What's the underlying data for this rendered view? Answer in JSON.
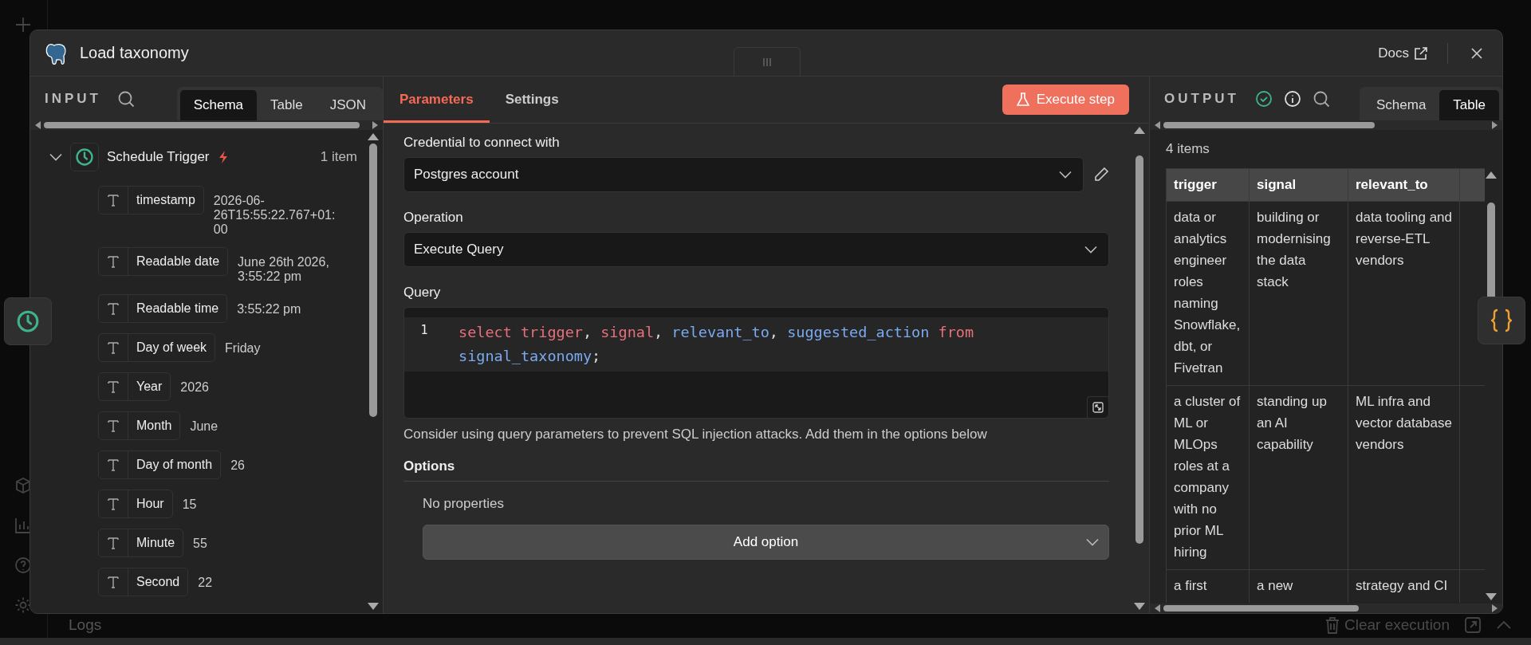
{
  "window": {
    "title": "Load taxonomy",
    "docs_link": "Docs"
  },
  "background": {
    "logs_label": "Logs",
    "clear_button": "Clear execution"
  },
  "input": {
    "title": "INPUT",
    "view_tabs": [
      {
        "label": "Schema",
        "selected": true
      },
      {
        "label": "Table",
        "selected": false
      },
      {
        "label": "JSON",
        "selected": false
      }
    ],
    "node": {
      "name": "Schedule Trigger",
      "count": "1 item",
      "expanded": true,
      "fields": [
        {
          "name": "timestamp",
          "value": "2026-06-26T15:55:22.767+01:00"
        },
        {
          "name": "Readable date",
          "value": "June 26th 2026, 3:55:22 pm"
        },
        {
          "name": "Readable time",
          "value": "3:55:22 pm"
        },
        {
          "name": "Day of week",
          "value": "Friday"
        },
        {
          "name": "Year",
          "value": "2026"
        },
        {
          "name": "Month",
          "value": "June"
        },
        {
          "name": "Day of month",
          "value": "26"
        },
        {
          "name": "Hour",
          "value": "15"
        },
        {
          "name": "Minute",
          "value": "55"
        },
        {
          "name": "Second",
          "value": "22"
        }
      ]
    }
  },
  "parameters": {
    "tabs": [
      {
        "label": "Parameters",
        "selected": true
      },
      {
        "label": "Settings",
        "selected": false
      }
    ],
    "execute_button": "Execute step",
    "credential": {
      "label": "Credential to connect with",
      "value": "Postgres account"
    },
    "operation": {
      "label": "Operation",
      "value": "Execute Query"
    },
    "query": {
      "label": "Query",
      "line_number": "1",
      "tokens": [
        {
          "text": "select",
          "kind": "keyword"
        },
        {
          "text": "trigger",
          "kind": "keyword"
        },
        {
          "text": ",",
          "kind": "punct"
        },
        {
          "text": "signal",
          "kind": "keyword"
        },
        {
          "text": ",",
          "kind": "punct"
        },
        {
          "text": "relevant_to",
          "kind": "name"
        },
        {
          "text": ",",
          "kind": "punct"
        },
        {
          "text": "suggested_action",
          "kind": "name"
        },
        {
          "text": "from",
          "kind": "keyword"
        },
        {
          "text": "signal_taxonomy",
          "kind": "name"
        },
        {
          "text": ";",
          "kind": "punct"
        }
      ]
    },
    "hint": "Consider using query parameters to prevent SQL injection attacks. Add them in the options below",
    "options": {
      "label": "Options",
      "empty_text": "No properties",
      "add_button": "Add option"
    }
  },
  "output": {
    "title": "OUTPUT",
    "view_tabs": [
      {
        "label": "Schema",
        "selected": false
      },
      {
        "label": "Table",
        "selected": true
      }
    ],
    "item_count": "4 items",
    "table": {
      "columns": [
        "trigger",
        "signal",
        "relevant_to"
      ],
      "rows": [
        [
          "data or analytics engineer roles naming Snowflake, dbt, or Fivetran",
          "building or modernising the data stack",
          "data tooling and reverse-ETL vendors"
        ],
        [
          "a cluster of ML or MLOps roles at a company with no prior ML hiring",
          "standing up an AI capability",
          "ML infra and vector database vendors"
        ],
        [
          "a first",
          "a new",
          "strategy and CI"
        ]
      ]
    }
  }
}
